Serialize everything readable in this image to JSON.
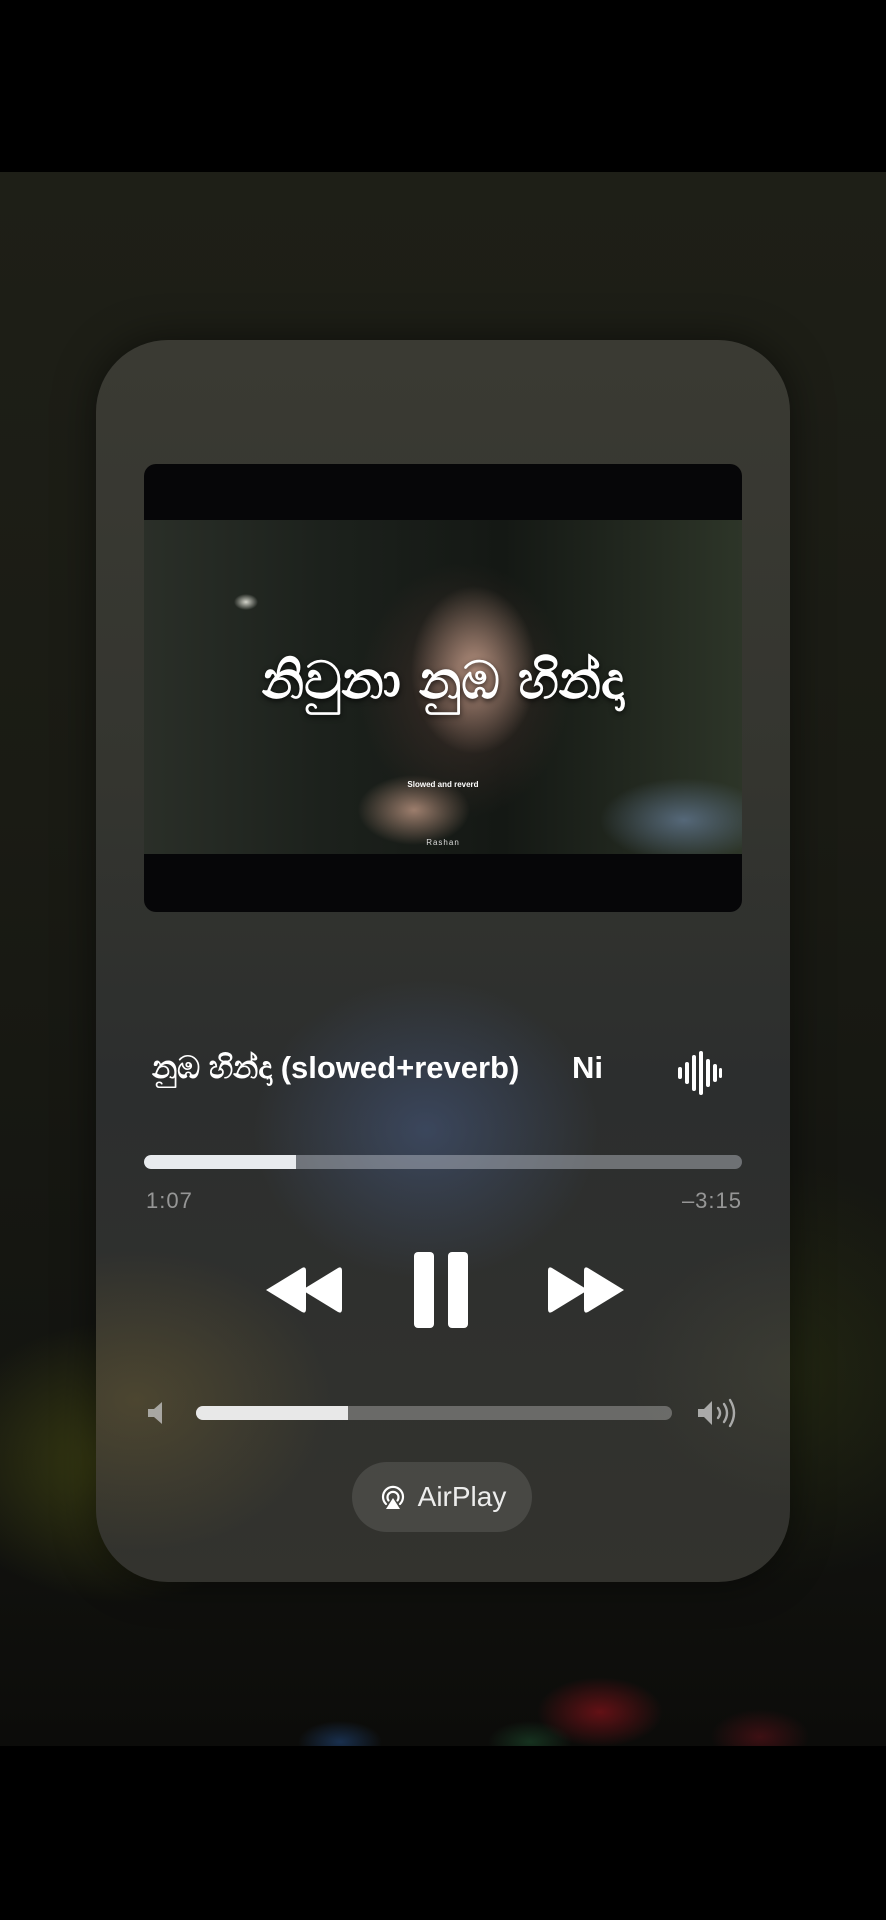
{
  "artwork": {
    "title": "නිවුනා නුඹ හින්දා",
    "subtitle": "Slowed and reverd",
    "credit": "Rashan"
  },
  "now_playing": {
    "title": "නුඹ හින්දා (slowed+reverb)",
    "next_text": "Ni"
  },
  "playback": {
    "elapsed": "1:07",
    "remaining": "–3:15",
    "progress_fraction": 0.255
  },
  "volume": {
    "level_fraction": 0.32
  },
  "airplay": {
    "label": "AirPlay"
  },
  "icons": {
    "waveform": "waveform-icon",
    "rewind": "rewind-icon",
    "pause": "pause-icon",
    "forward": "fast-forward-icon",
    "volume_low": "speaker-low-icon",
    "volume_high": "speaker-high-icon",
    "airplay": "airplay-icon"
  }
}
